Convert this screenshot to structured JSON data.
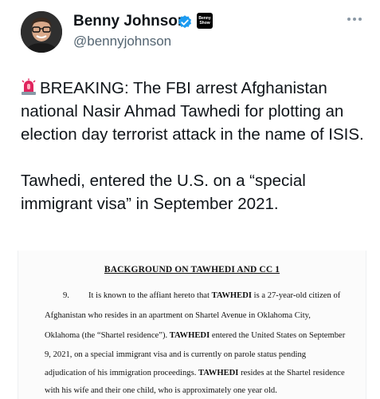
{
  "author": {
    "name": "Benny Johnson",
    "handle": "@bennyjohnson",
    "affiliate_badge_text": "Benny Show"
  },
  "tweet": {
    "paragraph1": "BREAKING: The FBI arrest Afghanistan national Nasir Ahmad Tawhedi for plotting an election day terrorist attack in the name of ISIS.",
    "paragraph2": "Tawhedi, entered the U.S. on a “special immigrant visa” in September 2021."
  },
  "document": {
    "heading": "BACKGROUND ON TAWHEDI AND CC 1",
    "paragraph_number": "9.",
    "lines": [
      [
        "It is known to the affiant hereto that ",
        "TAWHEDI",
        " is a 27-year-old citizen of"
      ],
      [
        "Afghanistan who resides in an apartment on Shartel Avenue in Oklahoma City,",
        "",
        ""
      ],
      [
        "Oklahoma (the “Shartel residence”). ",
        "TAWHEDI",
        " entered the United States on September"
      ],
      [
        "9, 2021, on a special immigrant visa and is currently on parole status pending",
        "",
        ""
      ],
      [
        "adjudication of his immigration proceedings.  ",
        "TAWHEDI",
        " resides at the Shartel residence"
      ],
      [
        "with his wife and their one child, who is approximately one year old.",
        "",
        ""
      ]
    ]
  },
  "colors": {
    "verified": "#1d9bf0",
    "handle": "#536471",
    "siren": "#e0245e"
  },
  "icons": [
    "avatar",
    "verified-badge-icon",
    "affiliate-badge-icon",
    "more-options-icon",
    "siren-emoji-icon"
  ]
}
